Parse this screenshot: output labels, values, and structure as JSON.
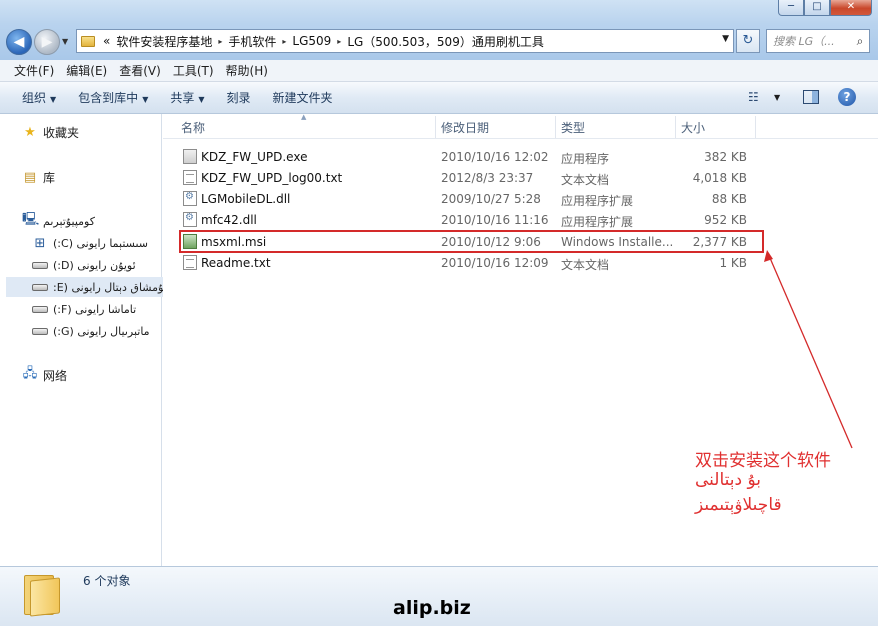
{
  "window": {
    "minimize_label": "─",
    "maximize_label": "□",
    "close_label": "✕"
  },
  "address": {
    "prefix": "«",
    "crumbs": [
      "软件安装程序基地",
      "手机软件",
      "LG509",
      "LG（500.503，509）通用刷机工具"
    ],
    "separator": "▸",
    "refresh_glyph": "↻"
  },
  "search": {
    "placeholder": "搜索 LG（..."
  },
  "menu": [
    "文件(F)",
    "编辑(E)",
    "查看(V)",
    "工具(T)",
    "帮助(H)"
  ],
  "toolbar": {
    "organize": "组织",
    "include_in_library": "包含到库中",
    "share": "共享",
    "burn": "刻录",
    "new_folder": "新建文件夹",
    "help_glyph": "?"
  },
  "nav": {
    "favorites": "收藏夹",
    "libraries": "库",
    "computer": "كومپيۇتېرىم",
    "drives": [
      {
        "label": "سىستېما رايونى (C:)"
      },
      {
        "label": "ئويۇن رايونى (D:)"
      },
      {
        "label": "يۇمشاق دېتال رايونى (E:"
      },
      {
        "label": "تاماشا رايونى (F:)"
      },
      {
        "label": "ماتېرىيال رايونى (G:)"
      }
    ],
    "network": "网络"
  },
  "columns": {
    "name": "名称",
    "date": "修改日期",
    "type": "类型",
    "size": "大小"
  },
  "files": [
    {
      "name": "KDZ_FW_UPD.exe",
      "date": "2010/10/16 12:02",
      "type": "应用程序",
      "size": "382 KB",
      "icon": "exe-icon"
    },
    {
      "name": "KDZ_FW_UPD_log00.txt",
      "date": "2012/8/3 23:37",
      "type": "文本文档",
      "size": "4,018 KB",
      "icon": "text-file-icon"
    },
    {
      "name": "LGMobileDL.dll",
      "date": "2009/10/27 5:28",
      "type": "应用程序扩展",
      "size": "88 KB",
      "icon": "dll-icon"
    },
    {
      "name": "mfc42.dll",
      "date": "2010/10/16 11:16",
      "type": "应用程序扩展",
      "size": "952 KB",
      "icon": "dll-icon"
    },
    {
      "name": "msxml.msi",
      "date": "2010/10/12 9:06",
      "type": "Windows Installe...",
      "size": "2,377 KB",
      "icon": "msi-icon"
    },
    {
      "name": "Readme.txt",
      "date": "2010/10/16 12:09",
      "type": "文本文档",
      "size": "1 KB",
      "icon": "text-file-icon"
    }
  ],
  "annotation": {
    "zh": "双击安装这个软件",
    "ug1": "بۇ دېتالنى",
    "ug2": "قاچىلاۋېتىمىز",
    "color": "#e03030"
  },
  "details": {
    "count": "6 个对象"
  },
  "watermark": "alip.biz"
}
